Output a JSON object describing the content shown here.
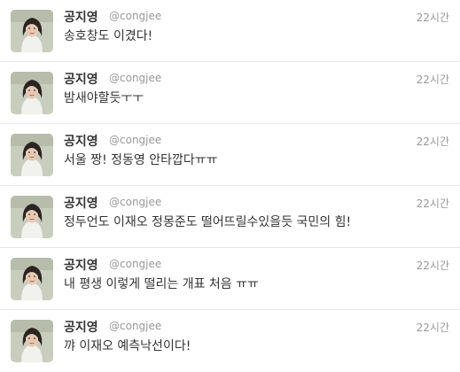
{
  "tweets": [
    {
      "name": "공지영",
      "handle": "@congjee",
      "time": "22시간",
      "text": "송호창도 이겼다!",
      "avatar_icon": "profile-photo"
    },
    {
      "name": "공지영",
      "handle": "@congjee",
      "time": "22시간",
      "text": "밤새야할듯ㅜㅜ",
      "avatar_icon": "profile-photo"
    },
    {
      "name": "공지영",
      "handle": "@congjee",
      "time": "22시간",
      "text": "서울 짱! 정동영 안타깝다ㅠㅠ",
      "avatar_icon": "profile-photo"
    },
    {
      "name": "공지영",
      "handle": "@congjee",
      "time": "22시간",
      "text": "정두언도 이재오 정몽준도 떨어뜨릴수있을듯 국민의 힘!",
      "avatar_icon": "profile-photo"
    },
    {
      "name": "공지영",
      "handle": "@congjee",
      "time": "22시간",
      "text": "내 평생 이렇게 떨리는 개표 처음 ㅠㅠ",
      "avatar_icon": "profile-photo"
    },
    {
      "name": "공지영",
      "handle": "@congjee",
      "time": "22시간",
      "text": "꺄 이재오 예측낙선이다!",
      "avatar_icon": "profile-photo"
    }
  ],
  "colors": {
    "name": "#333333",
    "meta": "#999999",
    "divider": "#e8e8e8"
  }
}
